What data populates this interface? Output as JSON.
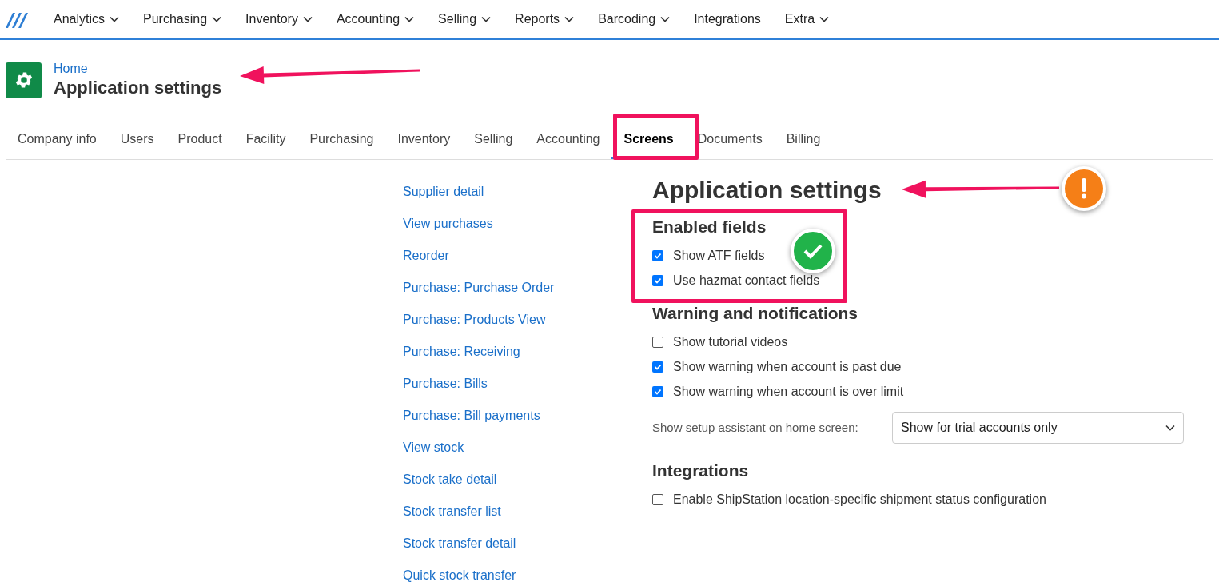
{
  "nav": [
    {
      "label": "Analytics",
      "dropdown": true
    },
    {
      "label": "Purchasing",
      "dropdown": true
    },
    {
      "label": "Inventory",
      "dropdown": true
    },
    {
      "label": "Accounting",
      "dropdown": true
    },
    {
      "label": "Selling",
      "dropdown": true
    },
    {
      "label": "Reports",
      "dropdown": true
    },
    {
      "label": "Barcoding",
      "dropdown": true
    },
    {
      "label": "Integrations",
      "dropdown": false
    },
    {
      "label": "Extra",
      "dropdown": true
    }
  ],
  "header": {
    "breadcrumb": "Home",
    "title": "Application settings"
  },
  "tabs": [
    {
      "label": "Company info",
      "selected": false
    },
    {
      "label": "Users",
      "selected": false
    },
    {
      "label": "Product",
      "selected": false
    },
    {
      "label": "Facility",
      "selected": false
    },
    {
      "label": "Purchasing",
      "selected": false
    },
    {
      "label": "Inventory",
      "selected": false
    },
    {
      "label": "Selling",
      "selected": false
    },
    {
      "label": "Accounting",
      "selected": false
    },
    {
      "label": "Screens",
      "selected": true
    },
    {
      "label": "Documents",
      "selected": false
    },
    {
      "label": "Billing",
      "selected": false
    }
  ],
  "screen_links": [
    "Supplier detail",
    "View purchases",
    "Reorder",
    "Purchase: Purchase Order",
    "Purchase: Products View",
    "Purchase: Receiving",
    "Purchase: Bills",
    "Purchase: Bill payments",
    "View stock",
    "Stock take detail",
    "Stock transfer list",
    "Stock transfer detail",
    "Quick stock transfer"
  ],
  "content": {
    "title": "Application settings",
    "sections": [
      {
        "title": "Enabled fields",
        "items": [
          {
            "kind": "checkbox",
            "label": "Show ATF fields",
            "checked": true
          },
          {
            "kind": "checkbox",
            "label": "Use hazmat contact fields",
            "checked": true
          }
        ]
      },
      {
        "title": "Warning and notifications",
        "items": [
          {
            "kind": "checkbox",
            "label": "Show tutorial videos",
            "checked": false
          },
          {
            "kind": "checkbox",
            "label": "Show warning when account is past due",
            "checked": true
          },
          {
            "kind": "checkbox",
            "label": "Show warning when account is over limit",
            "checked": true
          },
          {
            "kind": "select",
            "label": "Show setup assistant on home screen:",
            "value": "Show for trial accounts only"
          }
        ]
      },
      {
        "title": "Integrations",
        "items": [
          {
            "kind": "checkbox",
            "label": "Enable ShipStation location-specific shipment status configuration",
            "checked": false
          }
        ]
      }
    ]
  }
}
